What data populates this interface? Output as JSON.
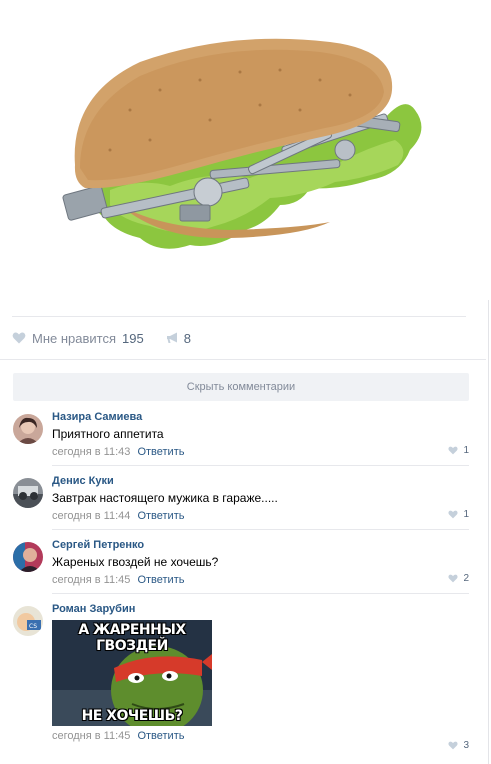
{
  "post": {
    "image_alt": "sandwich with bolts and screws",
    "actions": {
      "like_label": "Мне нравится",
      "like_count": "195",
      "share_count": "8"
    },
    "hide_comments_label": "Скрыть комментарии"
  },
  "comments": [
    {
      "author": "Назира Самиева",
      "text": "Приятного аппетита",
      "time": "сегодня в 11:43",
      "reply": "Ответить",
      "likes": "1"
    },
    {
      "author": "Денис Куки",
      "text": "Завтрак настоящего мужика в гараже.....",
      "time": "сегодня в 11:44",
      "reply": "Ответить",
      "likes": "1"
    },
    {
      "author": "Сергей Петренко",
      "text": "Жареных гвоздей не хочешь?",
      "time": "сегодня в 11:45",
      "reply": "Ответить",
      "likes": "2"
    },
    {
      "author": "Роман Зарубин",
      "meme_top": "А ЖАРЕННЫХ ГВОЗДЕЙ",
      "meme_bottom": "НЕ ХОЧЕШЬ?",
      "time": "сегодня в 11:45",
      "reply": "Ответить",
      "likes": "3"
    }
  ],
  "colors": {
    "link": "#2a5885",
    "muted": "#828a99",
    "button_bg": "#f0f2f5"
  }
}
